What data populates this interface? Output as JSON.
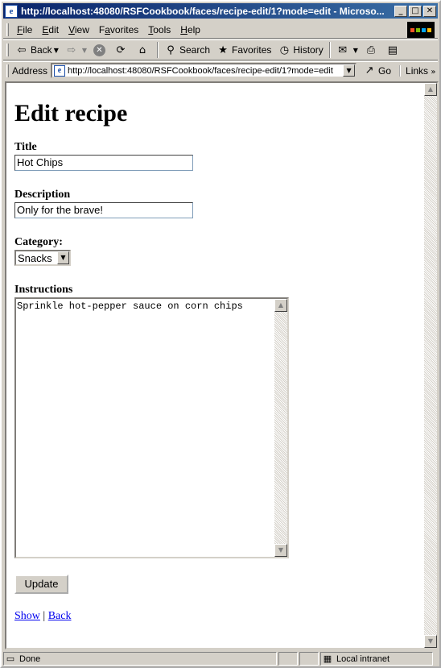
{
  "window": {
    "title": "http://localhost:48080/RSFCookbook/faces/recipe-edit/1?mode=edit - Microso...",
    "min_glyph": "_",
    "max_glyph": "□",
    "close_glyph": "✕"
  },
  "menu": {
    "items": [
      {
        "underline": "F",
        "rest": "ile"
      },
      {
        "underline": "E",
        "rest": "dit"
      },
      {
        "underline": "V",
        "rest": "iew"
      },
      {
        "underline": "F",
        "rest": "avorites",
        "pre": "",
        "alt": true
      },
      {
        "underline": "T",
        "rest": "ools"
      },
      {
        "underline": "H",
        "rest": "elp"
      }
    ]
  },
  "toolbar": {
    "back": "Back",
    "search": "Search",
    "favorites": "Favorites",
    "history": "History"
  },
  "address": {
    "label": "Address",
    "url": "http://localhost:48080/RSFCookbook/faces/recipe-edit/1?mode=edit",
    "go": "Go",
    "links": "Links"
  },
  "page": {
    "heading": "Edit recipe",
    "title_label": "Title",
    "title_value": "Hot Chips",
    "description_label": "Description",
    "description_value": "Only for the brave!",
    "category_label": "Category:",
    "category_value": "Snacks",
    "instructions_label": "Instructions",
    "instructions_value": "Sprinkle hot-pepper sauce on corn chips",
    "update_button": "Update",
    "show_link": "Show",
    "separator": "|",
    "back_link": "Back"
  },
  "status": {
    "text": "Done",
    "zone": "Local intranet"
  }
}
